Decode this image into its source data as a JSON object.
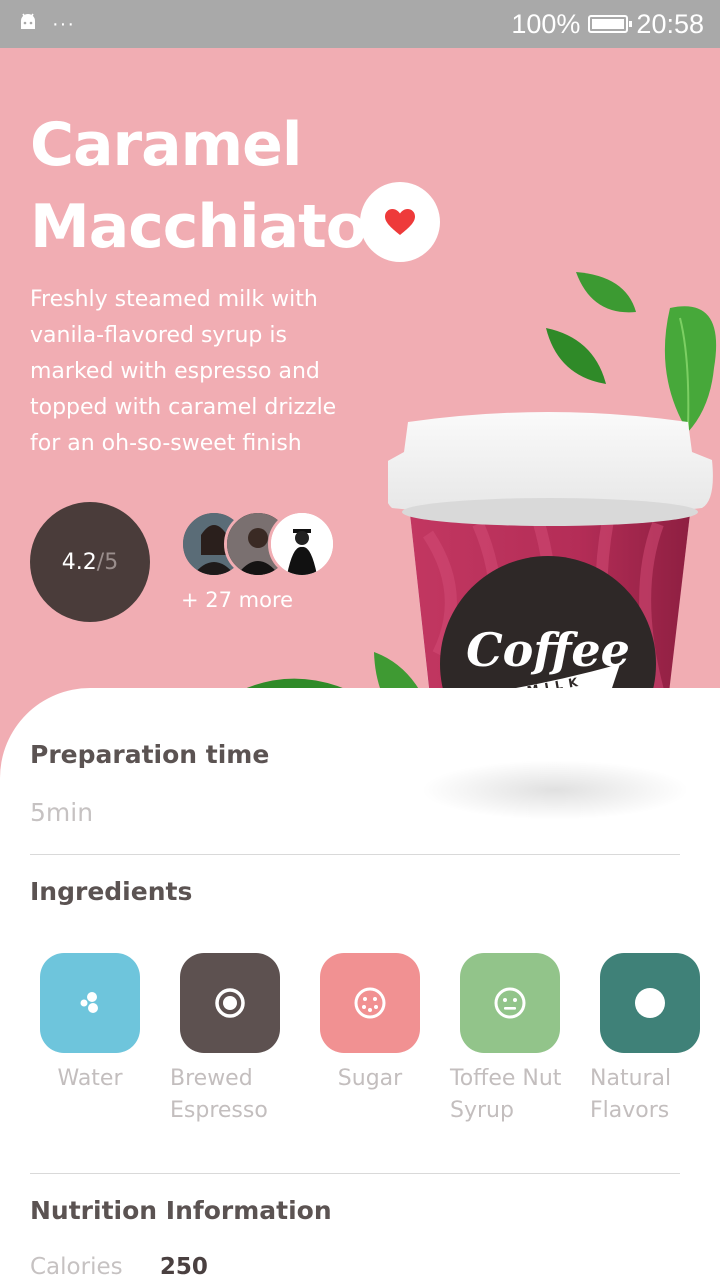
{
  "status_bar": {
    "battery": "100%",
    "time": "20:58",
    "dots": "···"
  },
  "product": {
    "title_line1": "Caramel",
    "title_line2": "Macchiato",
    "description": "Freshly steamed milk with vanila-flavored syrup is marked with espresso and topped with caramel drizzle for an oh-so-sweet finish",
    "rating_value": "4.2",
    "rating_scale": "/5",
    "more_reviewers": "+ 27 more",
    "cup_brand": "Coffee",
    "cup_sub": "MILK"
  },
  "preparation": {
    "heading": "Preparation time",
    "value": "5min"
  },
  "ingredients": {
    "heading": "Ingredients",
    "items": [
      {
        "label": "Water",
        "color": "#6ec5dc",
        "icon": "water-drops-icon"
      },
      {
        "label": "Brewed Espresso",
        "color": "#5d5150",
        "icon": "ring-icon"
      },
      {
        "label": "Sugar",
        "color": "#f19192",
        "icon": "cookie-icon"
      },
      {
        "label": "Toffee Nut Syrup",
        "color": "#92c48a",
        "icon": "face-icon"
      },
      {
        "label": "Natural Flavors",
        "color": "#3f8178",
        "icon": "dot-icon"
      }
    ]
  },
  "nutrition": {
    "heading": "Nutrition Information",
    "calories_label": "Calories",
    "calories_value": "250"
  },
  "colors": {
    "hero_bg": "#f1adb3",
    "heart": "#ee3a3a",
    "rating_bg": "#4a3c3a"
  }
}
